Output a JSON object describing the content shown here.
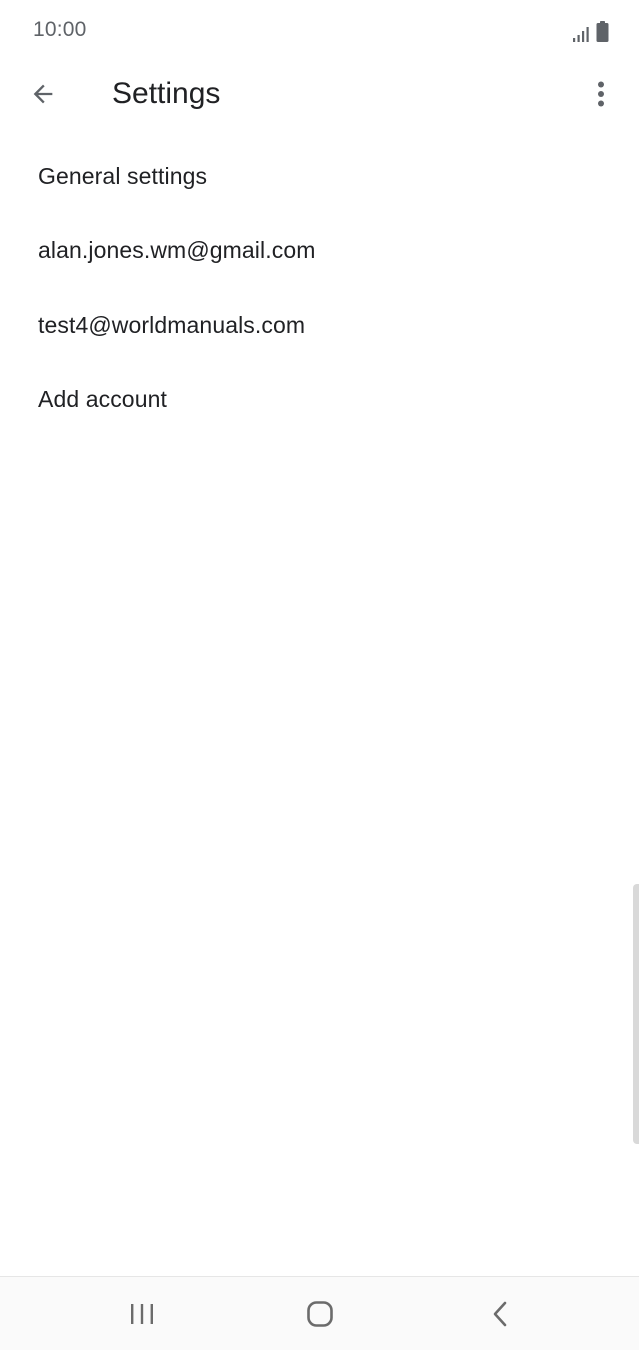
{
  "status_bar": {
    "time": "10:00",
    "icons": [
      "signal-icon",
      "battery-icon"
    ]
  },
  "app_bar": {
    "back_icon": "arrow-left-icon",
    "title": "Settings",
    "overflow_icon": "more-vert-icon"
  },
  "settings": {
    "items": [
      {
        "label": "General settings"
      },
      {
        "label": "alan.jones.wm@gmail.com"
      },
      {
        "label": "test4@worldmanuals.com"
      },
      {
        "label": "Add account"
      }
    ]
  },
  "nav_bar": {
    "icons": [
      "recent-apps-icon",
      "home-icon",
      "back-icon"
    ]
  },
  "colors": {
    "background": "#ffffff",
    "text_primary": "#202124",
    "text_secondary": "#5f6368",
    "icon": "#5f6368",
    "nav_background": "#fafafa"
  }
}
